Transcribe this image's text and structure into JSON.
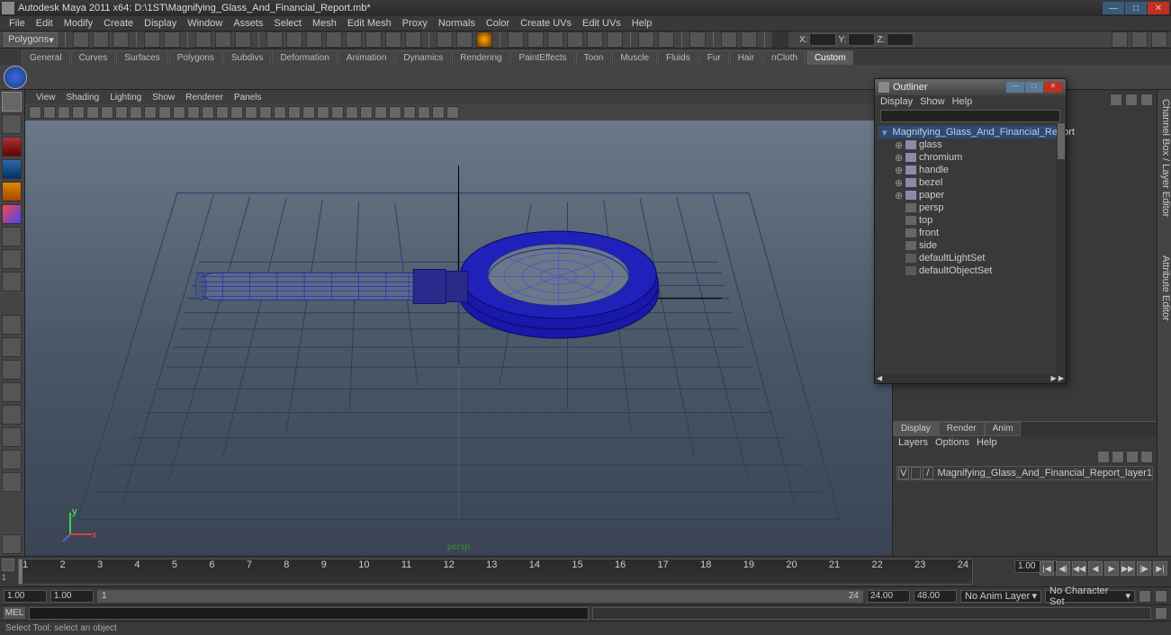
{
  "title": "Autodesk Maya 2011 x64: D:\\1ST\\Magnifying_Glass_And_Financial_Report.mb*",
  "menu": [
    "File",
    "Edit",
    "Modify",
    "Create",
    "Display",
    "Window",
    "Assets",
    "Select",
    "Mesh",
    "Edit Mesh",
    "Proxy",
    "Normals",
    "Color",
    "Create UVs",
    "Edit UVs",
    "Help"
  ],
  "mode_combo": "Polygons",
  "coords": {
    "x": "X:",
    "y": "Y:",
    "z": "Z:"
  },
  "shelf_tabs": [
    "General",
    "Curves",
    "Surfaces",
    "Polygons",
    "Subdivs",
    "Deformation",
    "Animation",
    "Dynamics",
    "Rendering",
    "PaintEffects",
    "Toon",
    "Muscle",
    "Fluids",
    "Fur",
    "Hair",
    "nCloth",
    "Custom"
  ],
  "shelf_active": "Custom",
  "vp_menu": [
    "View",
    "Shading",
    "Lighting",
    "Show",
    "Renderer",
    "Panels"
  ],
  "persp": "persp",
  "outliner": {
    "title": "Outliner",
    "menu": [
      "Display",
      "Show",
      "Help"
    ],
    "tree": [
      {
        "lvl": 0,
        "exp": "▾",
        "name": "Magnifying_Glass_And_Financial_Report",
        "sel": true,
        "icon": "grp"
      },
      {
        "lvl": 1,
        "exp": "⊕",
        "name": "glass",
        "icon": "mesh"
      },
      {
        "lvl": 1,
        "exp": "⊕",
        "name": "chromium",
        "icon": "mesh"
      },
      {
        "lvl": 1,
        "exp": "⊕",
        "name": "handle",
        "icon": "mesh"
      },
      {
        "lvl": 1,
        "exp": "⊕",
        "name": "bezel",
        "icon": "mesh"
      },
      {
        "lvl": 1,
        "exp": "⊕",
        "name": "paper",
        "icon": "mesh"
      },
      {
        "lvl": 1,
        "exp": "",
        "name": "persp",
        "icon": "cam",
        "dim": true
      },
      {
        "lvl": 1,
        "exp": "",
        "name": "top",
        "icon": "cam",
        "dim": true
      },
      {
        "lvl": 1,
        "exp": "",
        "name": "front",
        "icon": "cam",
        "dim": true
      },
      {
        "lvl": 1,
        "exp": "",
        "name": "side",
        "icon": "cam",
        "dim": true
      },
      {
        "lvl": 1,
        "exp": "",
        "name": "defaultLightSet",
        "icon": "set"
      },
      {
        "lvl": 1,
        "exp": "",
        "name": "defaultObjectSet",
        "icon": "set"
      }
    ]
  },
  "layers": {
    "tabs": [
      "Display",
      "Render",
      "Anim"
    ],
    "active": "Display",
    "menu": [
      "Layers",
      "Options",
      "Help"
    ],
    "rows": [
      {
        "v": "V",
        "p": "",
        "t": "/",
        "name": "Magnifying_Glass_And_Financial_Report_layer1"
      }
    ]
  },
  "timeline": {
    "ticks": [
      "1",
      "2",
      "3",
      "4",
      "5",
      "6",
      "7",
      "8",
      "9",
      "10",
      "11",
      "12",
      "13",
      "14",
      "15",
      "16",
      "17",
      "18",
      "19",
      "20",
      "21",
      "22",
      "23",
      "24"
    ],
    "cur": "1.00"
  },
  "range": {
    "start_out": "1.00",
    "start_in": "1.00",
    "slider_start": "1",
    "slider_end": "24",
    "end_in": "24.00",
    "end_out": "48.00",
    "anim_layer": "No Anim Layer",
    "char_set": "No Character Set"
  },
  "cmd": {
    "label": "MEL"
  },
  "help": "Select Tool: select an object",
  "side_tabs": [
    "Channel Box / Layer Editor",
    "Attribute Editor"
  ]
}
